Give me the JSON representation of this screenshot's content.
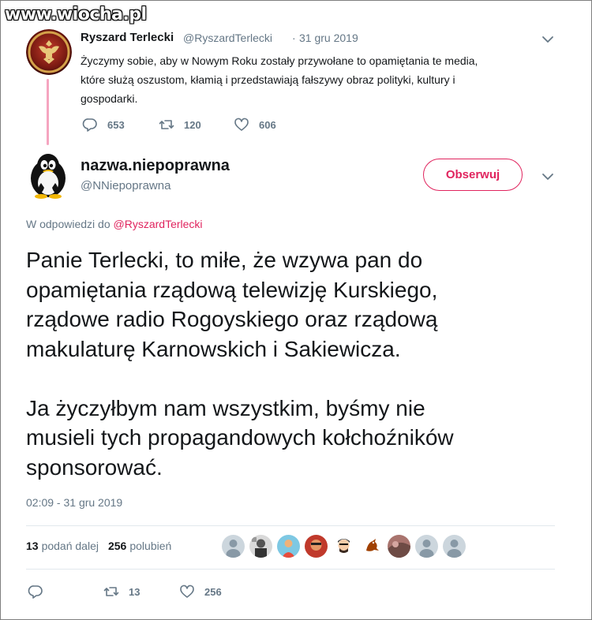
{
  "watermark": "www.wiocha.pl",
  "parent_tweet": {
    "author_name": "Ryszard Terlecki",
    "author_handle": "@RyszardTerlecki",
    "separator": "·",
    "date": "31 gru 2019",
    "text_lines": [
      "Życzymy sobie, aby w Nowym Roku zostały przywołane to opamiętania te media,",
      "które służą oszustom, kłamią i przedstawiają fałszywy obraz polityki, kultury i",
      "gospodarki."
    ],
    "replies": "653",
    "retweets": "120",
    "likes": "606",
    "icons": {
      "reply": "reply-icon",
      "retweet": "retweet-icon",
      "like": "heart-icon",
      "menu": "chevron-down-icon"
    }
  },
  "main_tweet": {
    "author_name": "nazwa.niepoprawna",
    "author_handle": "@NNiepoprawna",
    "follow_label": "Obserwuj",
    "reply_to_prefix": "W odpowiedzi do",
    "reply_to_handle": "@RyszardTerlecki",
    "paragraph1_lines": [
      "Panie Terlecki, to miłe, że wzywa pan do",
      "opamiętania rządową telewizję Kurskiego,",
      "rządowe radio Rogoyskiego oraz rządową",
      "makulaturę Karnowskich i Sakiewicza."
    ],
    "paragraph2_lines": [
      "Ja życzyłbym nam wszystkim, byśmy nie",
      "musieli tych propagandowych kołchoźników",
      "sponsorować."
    ],
    "timestamp": "02:09 - 31 gru 2019",
    "retweets_count": "13",
    "retweets_label": "podań dalej",
    "likes_count": "256",
    "likes_label": "polubień",
    "action_retweets": "13",
    "action_likes": "256"
  },
  "colors": {
    "accent": "#e0245e",
    "secondary_text": "#657786",
    "thread_line": "#f5a5c0",
    "divider": "#e1e8ed"
  }
}
